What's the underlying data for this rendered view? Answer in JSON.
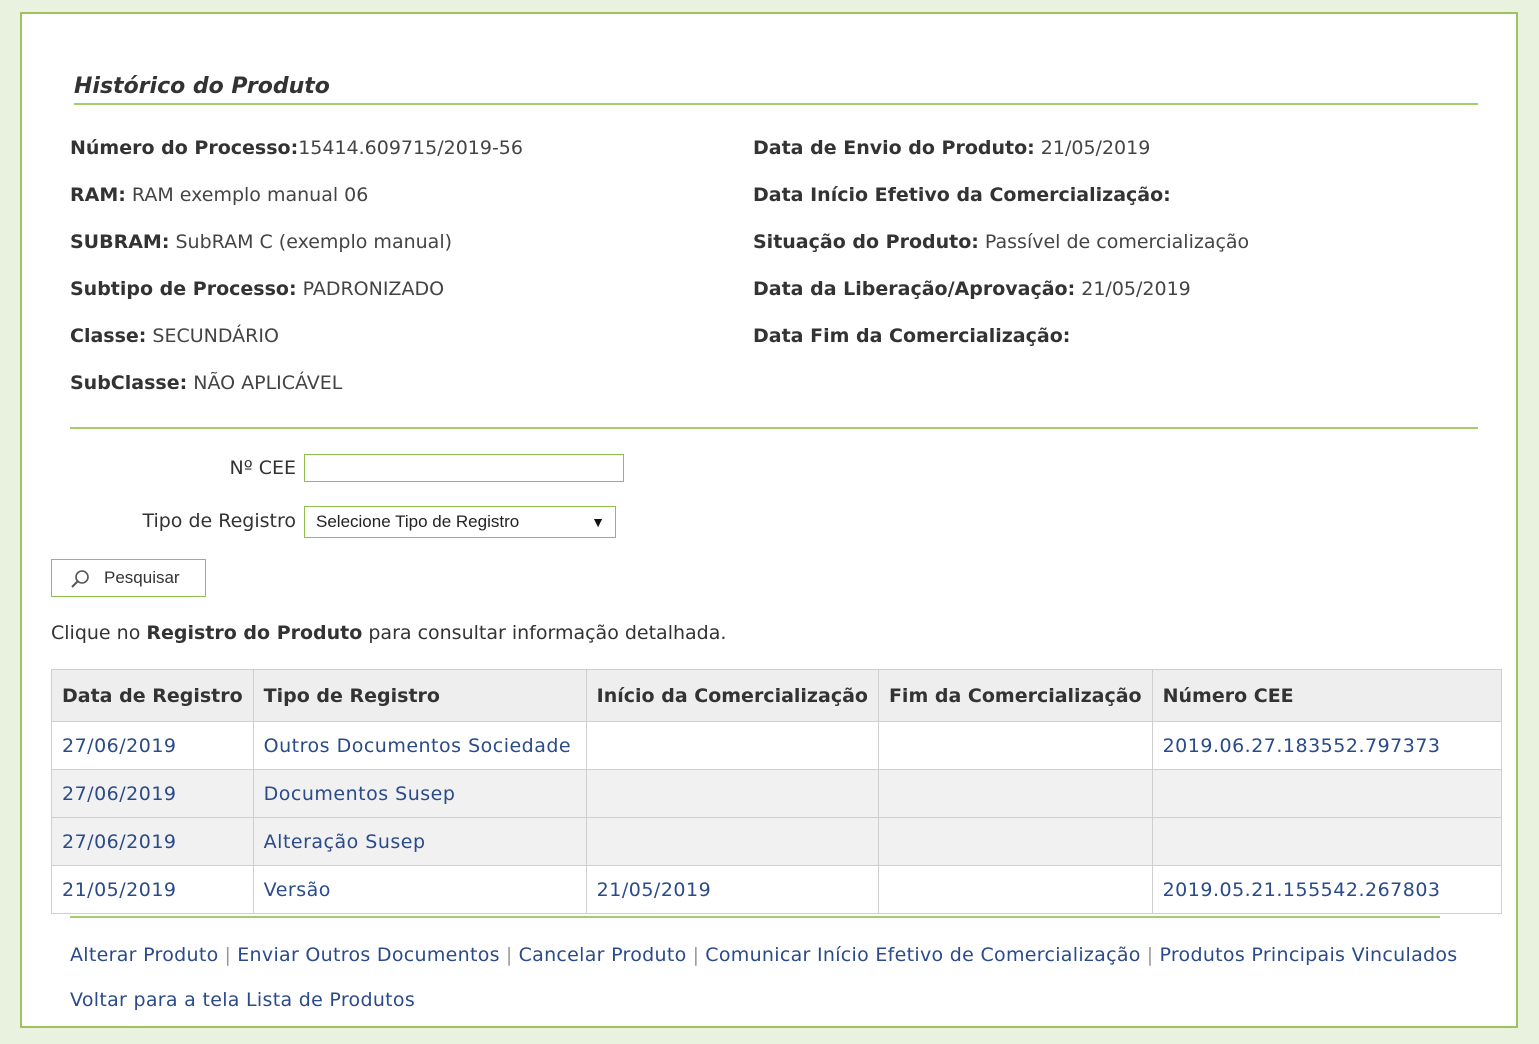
{
  "section_title": "Histórico do Produto",
  "info_left": [
    {
      "label": "Número do Processo:",
      "value": "15414.609715/2019-56"
    },
    {
      "label": "RAM:",
      "value": " RAM exemplo manual 06"
    },
    {
      "label": "SUBRAM:",
      "value": " SubRAM C (exemplo manual)"
    },
    {
      "label": "Subtipo de Processo:",
      "value": " PADRONIZADO"
    },
    {
      "label": "Classe:",
      "value": " SECUNDÁRIO"
    },
    {
      "label": "SubClasse:",
      "value": " NÃO APLICÁVEL"
    }
  ],
  "info_right": [
    {
      "label": "Data de Envio do Produto:",
      "value": " 21/05/2019"
    },
    {
      "label": "Data Início Efetivo da Comercialização:",
      "value": ""
    },
    {
      "label": "Situação do Produto:",
      "value": " Passível de comercialização"
    },
    {
      "label": "Data da Liberação/Aprovação:",
      "value": " 21/05/2019"
    },
    {
      "label": "Data Fim da Comercialização:",
      "value": ""
    }
  ],
  "form": {
    "cee_label": "Nº CEE",
    "cee_value": "",
    "tipo_label": "Tipo de Registro",
    "tipo_selected": "Selecione Tipo de Registro",
    "search_button": "Pesquisar"
  },
  "hint": {
    "prefix": "Clique no ",
    "bold": "Registro do Produto",
    "suffix": " para consultar informação detalhada."
  },
  "table": {
    "headers": [
      "Data de Registro",
      "Tipo de Registro",
      "Início da Comercialização",
      "Fim da Comercialização",
      "Número CEE"
    ],
    "rows": [
      [
        "27/06/2019",
        "Outros Documentos Sociedade",
        "",
        "",
        "2019.06.27.183552.797373"
      ],
      [
        "27/06/2019",
        "Documentos Susep",
        "",
        "",
        ""
      ],
      [
        "27/06/2019",
        "Alteração Susep",
        "",
        "",
        ""
      ],
      [
        "21/05/2019",
        "Versão",
        "21/05/2019",
        "",
        "2019.05.21.155542.267803"
      ]
    ]
  },
  "actions": [
    "Alterar Produto",
    "Enviar Outros Documentos",
    "Cancelar Produto",
    "Comunicar Início Efetivo de Comercialização",
    "Produtos Principais Vinculados"
  ],
  "separator": "|",
  "back_link": "Voltar para a tela Lista de Produtos",
  "colors": {
    "accent_green": "#9bc55a",
    "link_blue": "#2a4a8a"
  },
  "icons": {
    "search_button_icon": "magnifier-icon",
    "select_arrow": "dropdown-arrow-icon"
  }
}
